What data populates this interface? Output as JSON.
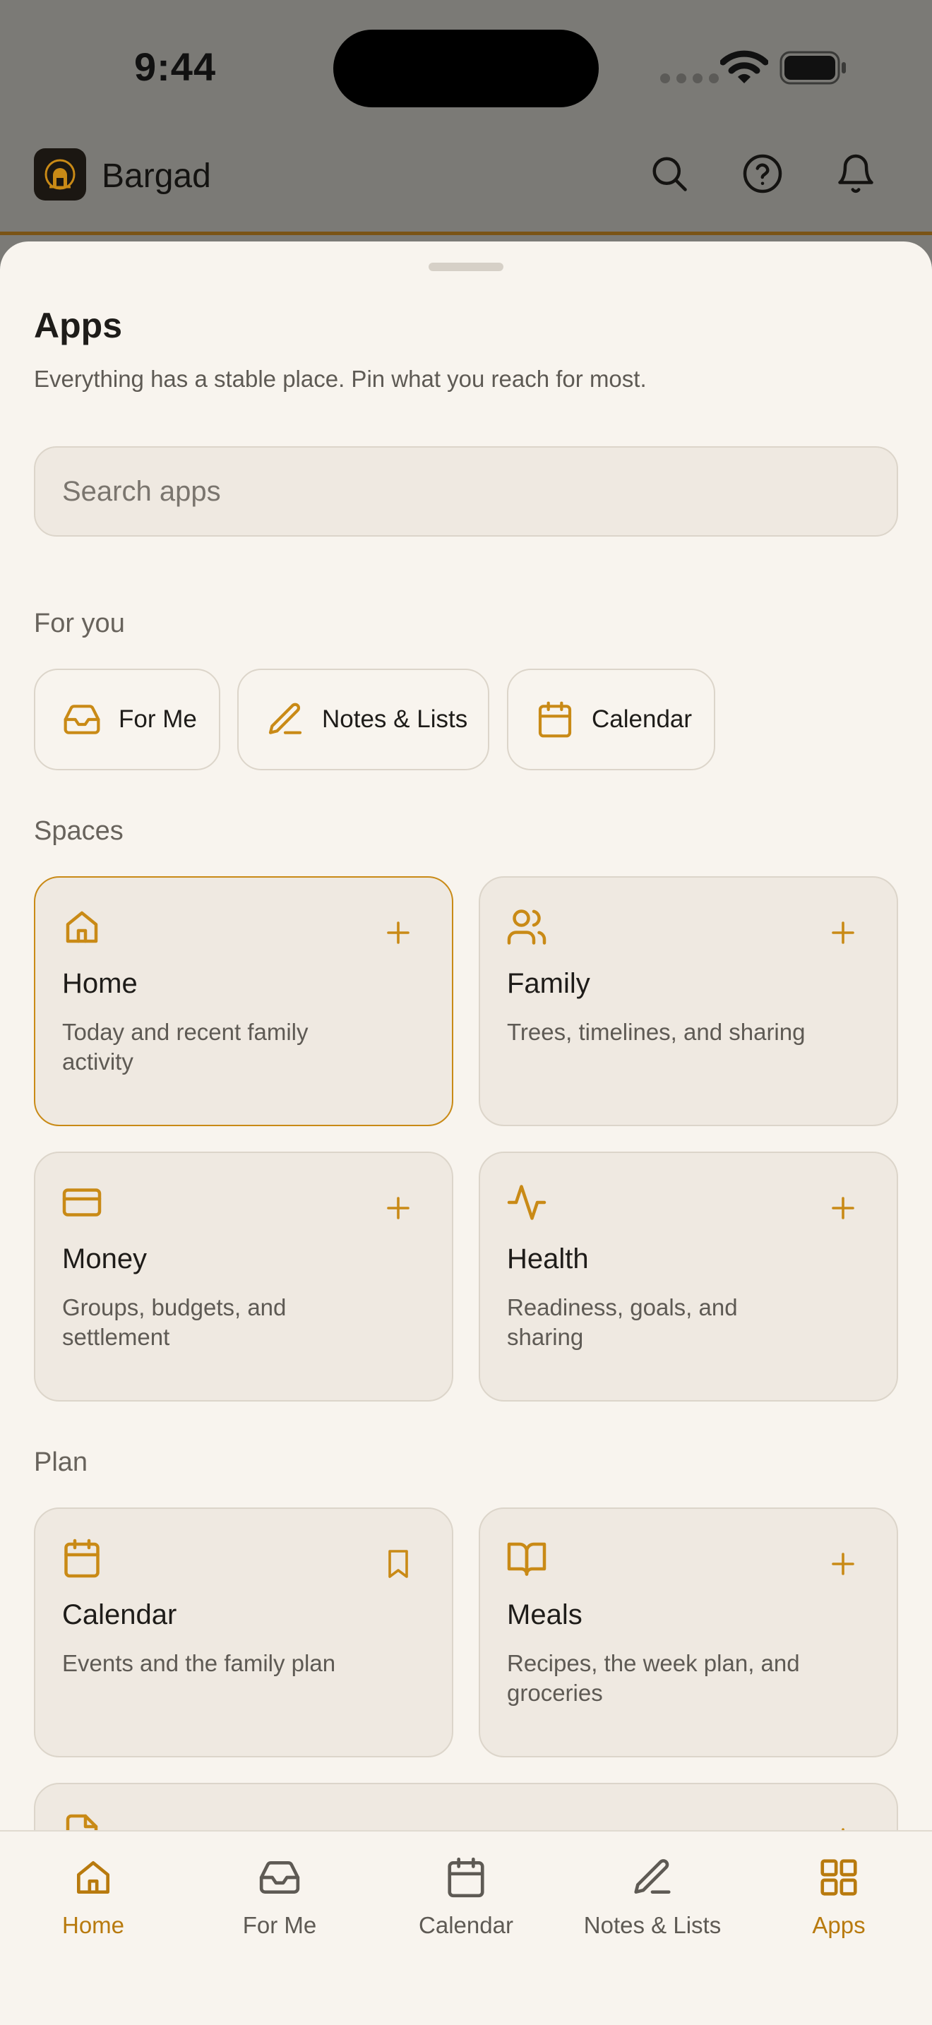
{
  "status_bar": {
    "time": "9:44"
  },
  "header": {
    "app_name": "Bargad"
  },
  "sheet": {
    "title": "Apps",
    "subtitle": "Everything has a stable place. Pin what you reach for most.",
    "search_placeholder": "Search apps"
  },
  "for_you": {
    "title": "For you",
    "items": [
      {
        "label": "For Me",
        "icon": "inbox-icon"
      },
      {
        "label": "Notes & Lists",
        "icon": "pencil-icon"
      },
      {
        "label": "Calendar",
        "icon": "calendar-icon"
      }
    ]
  },
  "spaces": {
    "title": "Spaces",
    "cards": [
      {
        "title": "Home",
        "desc": "Today and recent family activity",
        "icon": "home-icon",
        "action": "plus-icon",
        "selected": true
      },
      {
        "title": "Family",
        "desc": "Trees, timelines, and sharing",
        "icon": "users-icon",
        "action": "plus-icon"
      },
      {
        "title": "Money",
        "desc": "Groups, budgets, and settlement",
        "icon": "credit-card-icon",
        "action": "plus-icon"
      },
      {
        "title": "Health",
        "desc": "Readiness, goals, and sharing",
        "icon": "activity-icon",
        "action": "plus-icon"
      }
    ]
  },
  "plan": {
    "title": "Plan",
    "cards": [
      {
        "title": "Calendar",
        "desc": "Events and the family plan",
        "icon": "calendar-icon",
        "action": "bookmark-icon"
      },
      {
        "title": "Meals",
        "desc": "Recipes, the week plan, and groceries",
        "icon": "book-open-icon",
        "action": "plus-icon"
      }
    ]
  },
  "tabs": [
    {
      "label": "Home",
      "icon": "home-icon",
      "active": true
    },
    {
      "label": "For Me",
      "icon": "inbox-icon"
    },
    {
      "label": "Calendar",
      "icon": "calendar-icon"
    },
    {
      "label": "Notes & Lists",
      "icon": "pencil-icon"
    },
    {
      "label": "Apps",
      "icon": "grid-icon",
      "active": true
    }
  ],
  "colors": {
    "accent": "#c98a16",
    "tab_active": "#b87a0e",
    "sheet_bg": "#f8f4ee",
    "card_bg": "#efe9e1",
    "scrim": "#7b7a76"
  }
}
